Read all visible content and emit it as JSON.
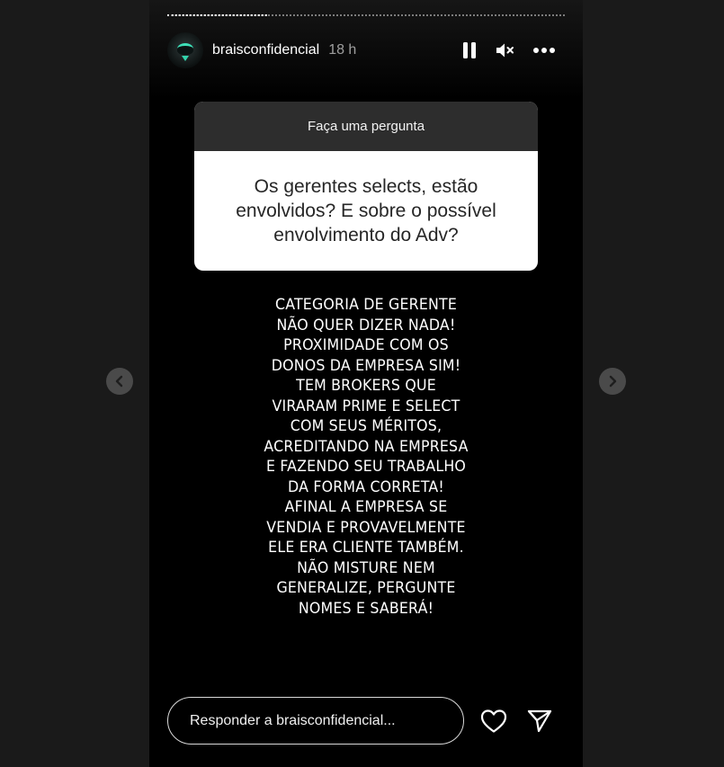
{
  "story": {
    "progress_fraction": 0.25,
    "user": {
      "username": "braisconfidencial",
      "timestamp": "18 h",
      "avatar_icon": "profile-avatar-icon"
    },
    "controls": {
      "pause_icon": "pause-icon",
      "mute_icon": "volume-muted-icon",
      "more_icon": "more-options-icon"
    }
  },
  "question_sticker": {
    "header": "Faça uma pergunta",
    "question": "Os gerentes selects, estão envolvidos? E sobre o possível envolvimento do Adv?"
  },
  "answer_lines": [
    "CATEGORIA DE GERENTE",
    "NÃO QUER DIZER NADA!",
    "PROXIMIDADE COM OS",
    "DONOS DA EMPRESA SIM!",
    "TEM BROKERS QUE",
    "VIRARAM PRIME E SELECT",
    "COM SEUS MÉRITOS,",
    "ACREDITANDO NA EMPRESA",
    "E FAZENDO SEU TRABALHO",
    "DA FORMA CORRETA!",
    "AFINAL A EMPRESA SE",
    "VENDIA E PROVAVELMENTE",
    "ELE ERA CLIENTE TAMBÉM.",
    "NÃO MISTURE NEM",
    "GENERALIZE, PERGUNTE",
    "NOMES E SABERÁ!"
  ],
  "reply": {
    "placeholder": "Responder a braisconfidencial...",
    "like_icon": "heart-icon",
    "send_icon": "send-icon"
  },
  "navigation": {
    "prev_icon": "chevron-left-icon",
    "next_icon": "chevron-right-icon"
  },
  "colors": {
    "background": "#1a1a1a",
    "story_background": "#000000",
    "sticker_header": "#2d2d2d",
    "sticker_body": "#ffffff"
  }
}
